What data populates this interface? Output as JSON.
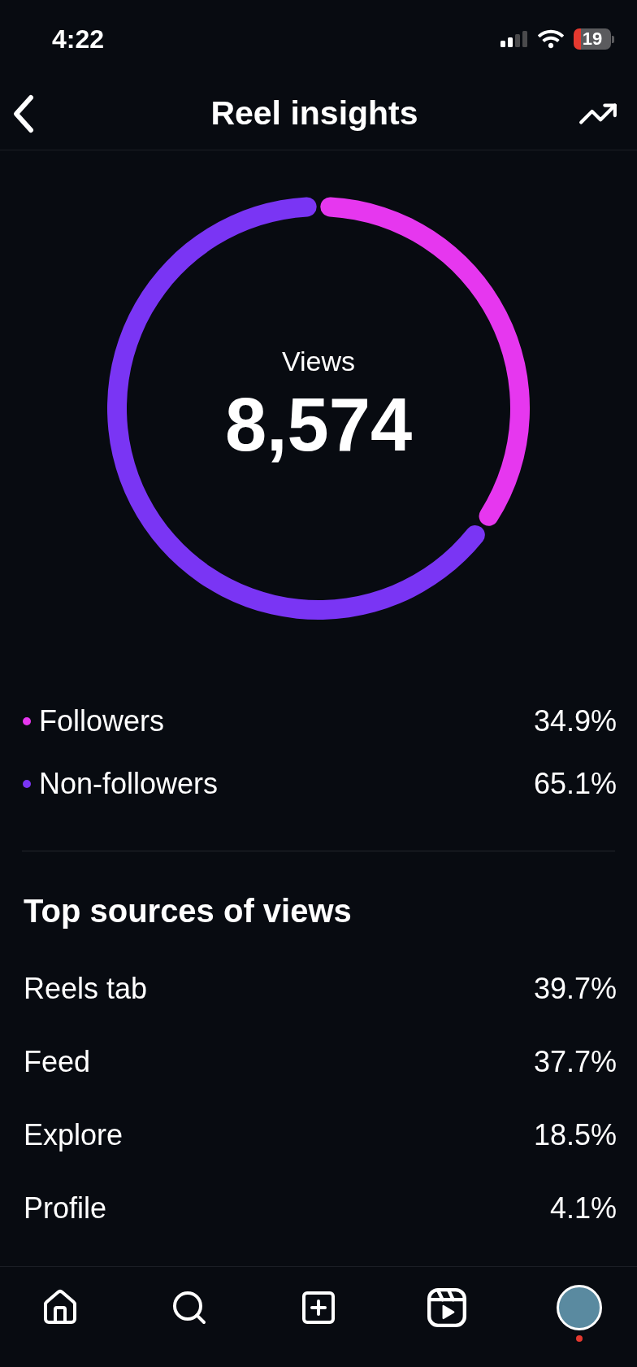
{
  "status_bar": {
    "time": "4:22",
    "battery": "19"
  },
  "header": {
    "title": "Reel insights"
  },
  "views": {
    "label": "Views",
    "total": "8,574",
    "chart_data": {
      "type": "donut",
      "categories": [
        "Followers",
        "Non-followers"
      ],
      "values": [
        34.9,
        65.1
      ]
    },
    "legend": [
      {
        "percent": "34.9%",
        "color": "#e637ef"
      },
      {
        "percent": "65.1%",
        "color": "#7a35f4"
      }
    ]
  },
  "top_sources": {
    "title": "Top sources of views",
    "rows": [
      {
        "name": "Reels tab",
        "percent": "39.7%"
      },
      {
        "name": "Feed",
        "percent": "37.7%"
      },
      {
        "name": "Explore",
        "percent": "18.5%"
      },
      {
        "name": "Profile",
        "percent": "4.1%"
      }
    ]
  }
}
